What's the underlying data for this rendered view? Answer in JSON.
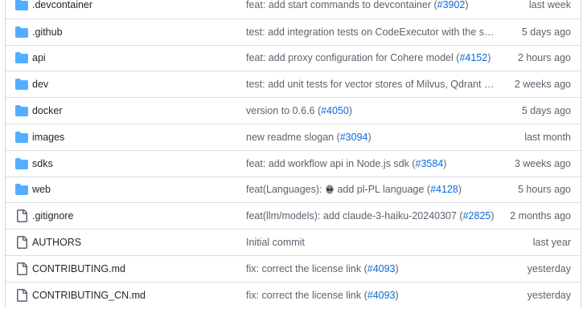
{
  "colors": {
    "folder": "#54aeff",
    "file": "#59636e",
    "link": "#0969da",
    "text": "#1f2328",
    "muted": "#59636e",
    "border": "#d8dee4"
  },
  "rows": [
    {
      "type": "folder",
      "icon": "folder-icon",
      "name": ".devcontainer",
      "msg_pre": "feat: add start commands to devcontainer (",
      "issue": "#3902",
      "msg_post": ")",
      "date": "last week"
    },
    {
      "type": "folder",
      "icon": "folder-icon",
      "name": ".github",
      "msg_pre": "test: add integration tests on CodeExecutor with the sandbox service",
      "issue": "",
      "msg_post": "",
      "date": "5 days ago"
    },
    {
      "type": "folder",
      "icon": "folder-icon",
      "name": "api",
      "msg_pre": "feat: add proxy configuration for Cohere model (",
      "issue": "#4152",
      "msg_post": ")",
      "date": "2 hours ago"
    },
    {
      "type": "folder",
      "icon": "folder-icon",
      "name": "dev",
      "msg_pre": "test: add unit tests for vector stores of Milvus, Qdrant and Weaviate",
      "issue": "",
      "msg_post": "",
      "date": "2 weeks ago"
    },
    {
      "type": "folder",
      "icon": "folder-icon",
      "name": "docker",
      "msg_pre": "version to 0.6.6 (",
      "issue": "#4050",
      "msg_post": ")",
      "date": "5 days ago"
    },
    {
      "type": "folder",
      "icon": "folder-icon",
      "name": "images",
      "msg_pre": "new readme slogan (",
      "issue": "#3094",
      "msg_post": ")",
      "date": "last month"
    },
    {
      "type": "folder",
      "icon": "folder-icon",
      "name": "sdks",
      "msg_pre": "feat: add workflow api in Node.js sdk (",
      "issue": "#3584",
      "msg_post": ")",
      "date": "3 weeks ago"
    },
    {
      "type": "folder",
      "icon": "folder-icon",
      "name": "web",
      "msg_pre": "feat(Languages): ",
      "emoji": "alien-emoji-icon",
      "msg_pre2": " add pl-PL language (",
      "issue": "#4128",
      "msg_post": ")",
      "date": "5 hours ago"
    },
    {
      "type": "file",
      "icon": "file-icon",
      "name": ".gitignore",
      "msg_pre": "feat(llm/models): add claude-3-haiku-20240307 (",
      "issue": "#2825",
      "msg_post": ")",
      "date": "2 months ago"
    },
    {
      "type": "file",
      "icon": "file-icon",
      "name": "AUTHORS",
      "msg_pre": "Initial commit",
      "issue": "",
      "msg_post": "",
      "date": "last year"
    },
    {
      "type": "file",
      "icon": "file-icon",
      "name": "CONTRIBUTING.md",
      "msg_pre": "fix: correct the license link (",
      "issue": "#4093",
      "msg_post": ")",
      "date": "yesterday"
    },
    {
      "type": "file",
      "icon": "file-icon",
      "name": "CONTRIBUTING_CN.md",
      "msg_pre": "fix: correct the license link (",
      "issue": "#4093",
      "msg_post": ")",
      "date": "yesterday"
    }
  ]
}
